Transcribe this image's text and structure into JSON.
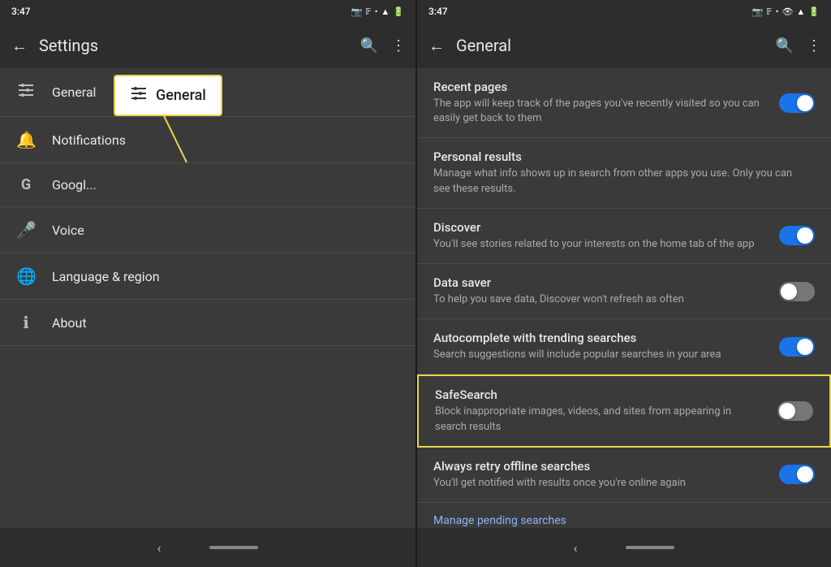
{
  "leftPanel": {
    "statusBar": {
      "time": "3:47",
      "icons": [
        "📷",
        "𝔽",
        "•"
      ]
    },
    "topBar": {
      "title": "Settings",
      "backLabel": "←",
      "searchLabel": "🔍",
      "moreLabel": "⋮"
    },
    "menuItems": [
      {
        "id": "general",
        "icon": "≡",
        "label": "General",
        "hasYellowDot": true
      },
      {
        "id": "notifications",
        "icon": "🔔",
        "label": "Notifications"
      },
      {
        "id": "google",
        "icon": "G",
        "label": "Googl..."
      },
      {
        "id": "voice",
        "icon": "🎤",
        "label": "Voice"
      },
      {
        "id": "language",
        "icon": "🌐",
        "label": "Language & region"
      },
      {
        "id": "about",
        "icon": "ℹ",
        "label": "About"
      }
    ],
    "annotation": {
      "icon": "≡",
      "label": "General"
    }
  },
  "rightPanel": {
    "statusBar": {
      "time": "3:47",
      "icons": [
        "📷",
        "𝔽",
        "•"
      ]
    },
    "topBar": {
      "title": "General",
      "backLabel": "←",
      "searchLabel": "🔍",
      "moreLabel": "⋮"
    },
    "settingsItems": [
      {
        "id": "recent-pages",
        "title": "Recent pages",
        "desc": "The app will keep track of the pages you've recently visited so you can easily get back to them",
        "toggle": "on",
        "highlighted": false
      },
      {
        "id": "personal-results",
        "title": "Personal results",
        "desc": "Manage what info shows up in search from other apps you use. Only you can see these results.",
        "toggle": null,
        "highlighted": false
      },
      {
        "id": "discover",
        "title": "Discover",
        "desc": "You'll see stories related to your interests on the home tab of the app",
        "toggle": "on",
        "highlighted": false
      },
      {
        "id": "data-saver",
        "title": "Data saver",
        "desc": "To help you save data, Discover won't refresh as often",
        "toggle": "off",
        "highlighted": false
      },
      {
        "id": "autocomplete",
        "title": "Autocomplete with trending searches",
        "desc": "Search suggestions will include popular searches in your area",
        "toggle": "on",
        "highlighted": false
      },
      {
        "id": "safesearch",
        "title": "SafeSearch",
        "desc": "Block inappropriate images, videos, and sites from appearing in search results",
        "toggle": "off",
        "highlighted": true
      },
      {
        "id": "retry-offline",
        "title": "Always retry offline searches",
        "desc": "You'll get notified with results once you're online again",
        "toggle": "on",
        "highlighted": false
      }
    ],
    "manageLink": "Manage pending searches"
  }
}
